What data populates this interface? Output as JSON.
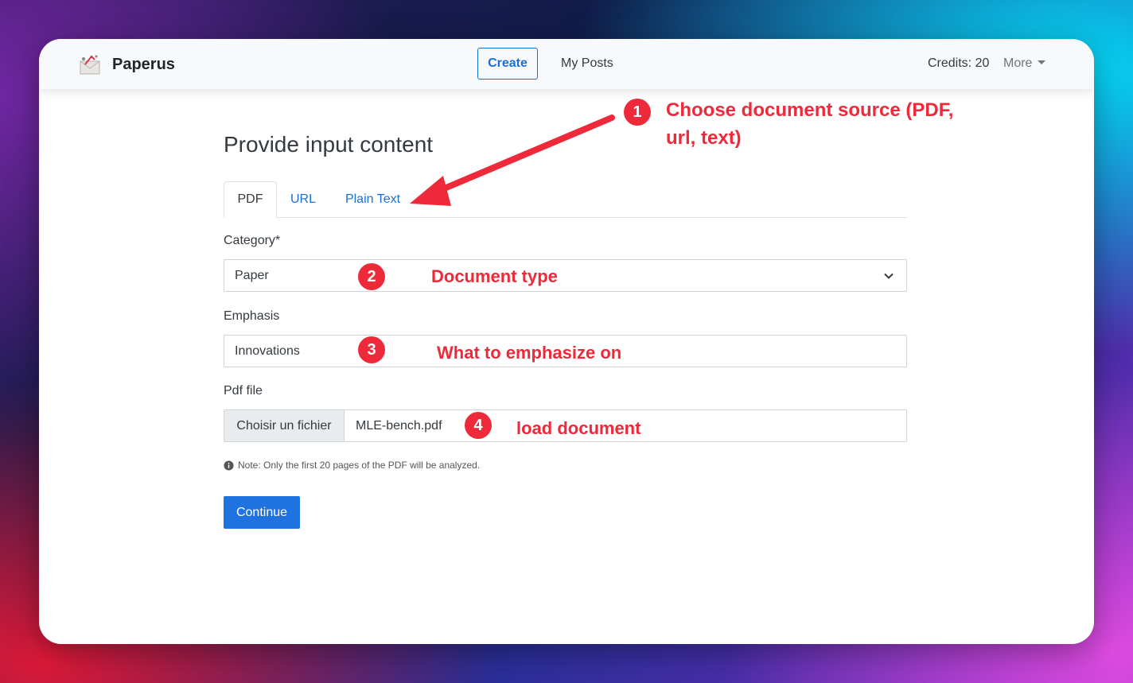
{
  "navbar": {
    "brand": "Paperus",
    "create_label": "Create",
    "posts_label": "My Posts",
    "credits_label": "Credits: 20",
    "more_label": "More"
  },
  "main": {
    "title": "Provide input content",
    "tabs": [
      {
        "label": "PDF",
        "active": true
      },
      {
        "label": "URL",
        "active": false
      },
      {
        "label": "Plain Text",
        "active": false
      }
    ],
    "category": {
      "label": "Category*",
      "value": "Paper"
    },
    "emphasis": {
      "label": "Emphasis",
      "value": "Innovations"
    },
    "pdf_file": {
      "label": "Pdf file",
      "button_label": "Choisir un fichier",
      "file_name": "MLE-bench.pdf"
    },
    "note": "Note: Only the first 20 pages of the PDF will be analyzed.",
    "continue_label": "Continue"
  },
  "annotations": [
    {
      "number": "1",
      "text": "Choose document source (PDF, url, text)"
    },
    {
      "number": "2",
      "text": "Document type"
    },
    {
      "number": "3",
      "text": "What to emphasize on"
    },
    {
      "number": "4",
      "text": "load document"
    }
  ],
  "colors": {
    "accent": "#1a6fd6",
    "annotation": "#ee2a3a",
    "button": "#1f73e0"
  },
  "icons": [
    "logo-icon",
    "chevron-down-icon",
    "info-icon",
    "arrow-icon"
  ]
}
